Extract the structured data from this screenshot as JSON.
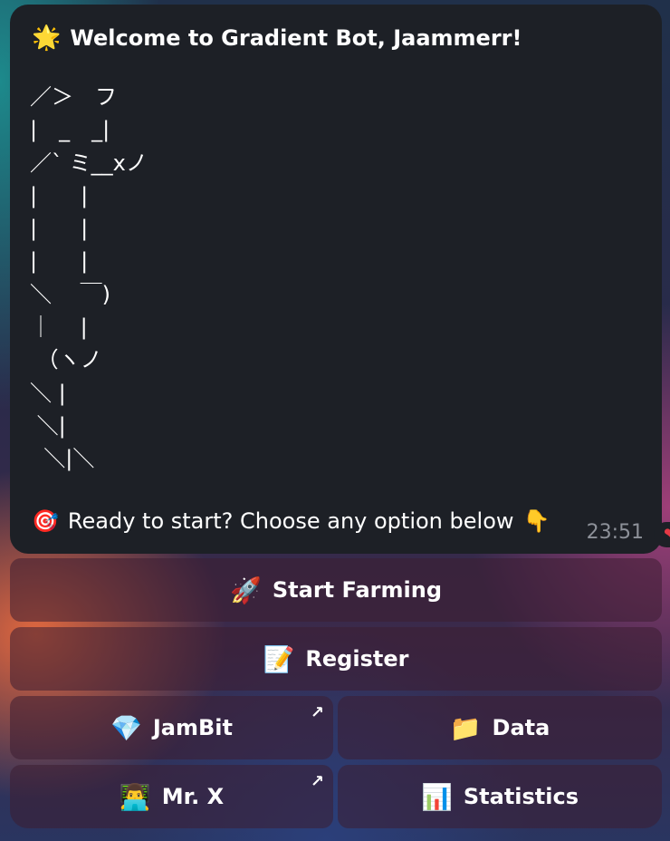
{
  "message": {
    "welcome_icon": "🌟",
    "welcome_text": "Welcome to Gradient Bot, Jaammerr!",
    "ascii_art": "／＞　フ\n|　_　_|\n／` ミ__xノ\n|　　|\n|　　|\n|　　|\n＼　 ￣)\n｜　 |\n （ヽノ\n＼ |\n ＼|\n  ＼|＼",
    "ready_icon": "🎯",
    "ready_text": "Ready to start? Choose any option below",
    "pointer_icon": "👇",
    "timestamp": "23:51",
    "reaction_icon": "❤"
  },
  "keyboard": {
    "start_farming": {
      "icon": "🚀",
      "label": "Start Farming"
    },
    "register": {
      "icon": "📝",
      "label": "Register"
    },
    "jambit": {
      "icon": "💎",
      "label": "JamBit",
      "external_icon": "↗"
    },
    "data": {
      "icon": "📁",
      "label": "Data"
    },
    "mr_x": {
      "icon": "👨‍💻",
      "label": "Mr. X",
      "external_icon": "↗"
    },
    "statistics": {
      "icon": "📊",
      "label": "Statistics"
    }
  }
}
